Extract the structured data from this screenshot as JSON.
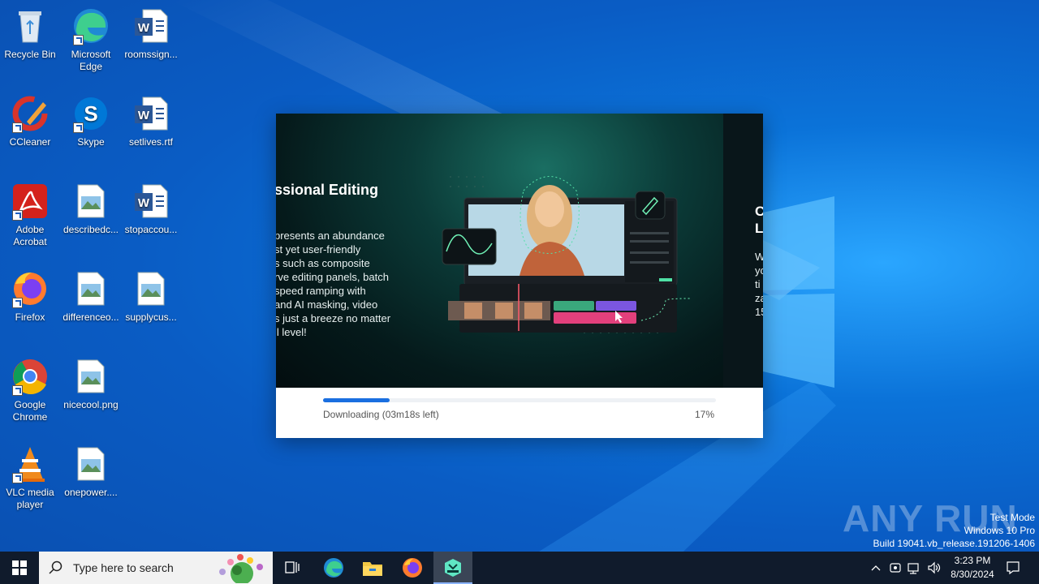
{
  "desktop": {
    "icons": [
      {
        "label": "Recycle Bin",
        "icon": "recycle-bin-icon"
      },
      {
        "label": "Microsoft Edge",
        "icon": "edge-icon"
      },
      {
        "label": "roomssign...",
        "icon": "word-document-icon"
      },
      {
        "label": "CCleaner",
        "icon": "ccleaner-icon"
      },
      {
        "label": "Skype",
        "icon": "skype-icon"
      },
      {
        "label": "setlives.rtf",
        "icon": "word-document-icon"
      },
      {
        "label": "Adobe Acrobat",
        "icon": "acrobat-icon"
      },
      {
        "label": "describedc...",
        "icon": "image-file-icon"
      },
      {
        "label": "stopaccou...",
        "icon": "word-document-icon"
      },
      {
        "label": "Firefox",
        "icon": "firefox-icon"
      },
      {
        "label": "differenceo...",
        "icon": "image-file-icon"
      },
      {
        "label": "supplycus...",
        "icon": "image-file-icon"
      },
      {
        "label": "Google Chrome",
        "icon": "chrome-icon"
      },
      {
        "label": "nicecool.png",
        "icon": "image-file-icon"
      },
      {
        "label": "VLC media player",
        "icon": "vlc-icon"
      },
      {
        "label": "onepower....",
        "icon": "image-file-icon"
      }
    ]
  },
  "installer": {
    "slide_title": "ssional Editing",
    "slide_body": [
      "presents an abundance",
      "st yet user-friendly",
      "s such as composite",
      "rve editing panels, batch",
      "speed ramping with",
      "and AI masking, video",
      "s just a breeze no matter",
      "ll level!"
    ],
    "next_title": [
      "C",
      "L"
    ],
    "next_body": [
      "W",
      "yo",
      "ti",
      "za",
      "15"
    ],
    "progress_label": "Downloading (03m18s left)",
    "progress_percent_text": "17%",
    "progress_value": 0.17,
    "accent_color": "#1a6fe0"
  },
  "watermark": {
    "text": "ANY RUN",
    "mode": "Test Mode",
    "os": "Windows 10 Pro",
    "build": "Build 19041.vb_release.191206-1406"
  },
  "taskbar": {
    "search_placeholder": "Type here to search",
    "time": "3:23 PM",
    "date": "8/30/2024",
    "apps": [
      "task-view-icon",
      "edge-icon",
      "file-explorer-icon",
      "firefox-icon",
      "installer-app-icon"
    ]
  }
}
